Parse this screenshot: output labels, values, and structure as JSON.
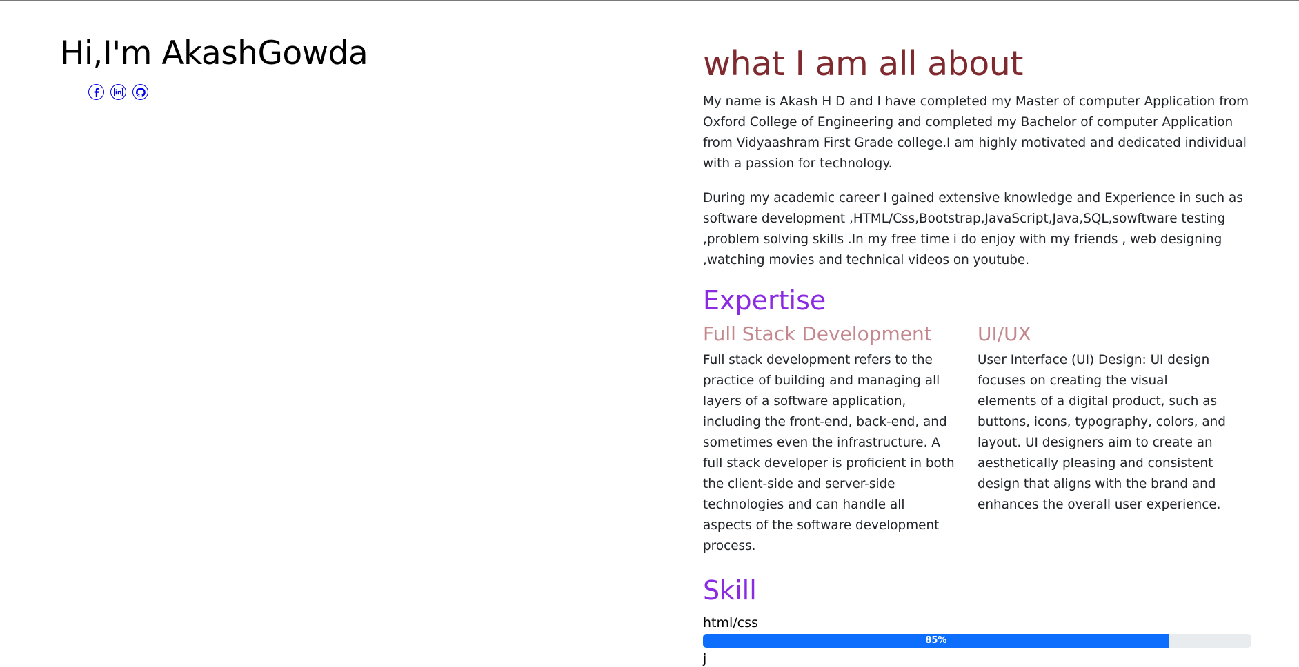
{
  "hero": {
    "title": "Hi,I'm AkashGowda"
  },
  "socials": [
    {
      "name": "facebook-icon"
    },
    {
      "name": "linkedin-icon"
    },
    {
      "name": "github-icon"
    }
  ],
  "about": {
    "title": "what I am all about",
    "paragraph1": "My name is Akash H D and I have completed my Master of computer Application from Oxford College of Engineering and completed my Bachelor of computer Application from Vidyaashram First Grade college.I am highly motivated and dedicated individual with a passion for technology.",
    "paragraph2": "During my academic career I gained extensive knowledge and Experience in such as software development ,HTML/Css,Bootstrap,JavaScript,Java,SQL,sowftware testing ,problem solving skills .In my free time i do enjoy with my friends , web designing ,watching movies and technical videos on youtube."
  },
  "expertise": {
    "title": "Expertise",
    "items": [
      {
        "heading": "Full Stack Development",
        "text": "Full stack development refers to the practice of building and managing all layers of a software application, including the front-end, back-end, and sometimes even the infrastructure. A full stack developer is proficient in both the client-side and server-side technologies and can handle all aspects of the software development process."
      },
      {
        "heading": "UI/UX",
        "text": "User Interface (UI) Design: UI design focuses on creating the visual elements of a digital product, such as buttons, icons, typography, colors, and layout. UI designers aim to create an aesthetically pleasing and consistent design that aligns with the brand and enhances the overall user experience."
      }
    ]
  },
  "skill": {
    "title": "Skill",
    "items": [
      {
        "label": "html/css",
        "percent": 85,
        "percent_label": "85%"
      }
    ],
    "next_label": "j"
  },
  "colors": {
    "about_title": "#7f2a2f",
    "section_title": "#8a2be2",
    "subheading": "#c4878d",
    "progress_fill": "#0d6efd",
    "progress_track": "#e9ecef",
    "link": "#0000ee"
  }
}
